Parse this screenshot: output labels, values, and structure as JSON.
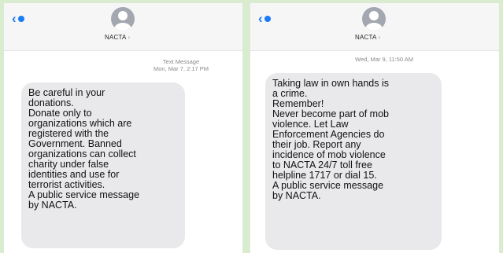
{
  "left_screen": {
    "contact_name": "NACTA",
    "meta_line1": "Text Message",
    "meta_line2": "Mon, Mar 7, 2:17 PM",
    "message_lines": [
      "Be careful in your",
      "donations.",
      "Donate only to",
      "organizations which are",
      "registered with the",
      "Government. Banned",
      "organizations can collect",
      "charity under false",
      "identities and use for",
      "terrorist activities.",
      "A public service message",
      "by NACTA."
    ]
  },
  "right_screen": {
    "contact_name": "NACTA",
    "meta_line1": "Wed, Mar 9, 11:50 AM",
    "message_lines": [
      "Taking law in own hands is",
      "a crime.",
      "Remember!",
      "Never become part of mob",
      "violence. Let Law",
      "Enforcement Agencies do",
      "their job. Report any",
      "incidence of mob violence",
      "to NACTA 24/7 toll free",
      "helpline 1717 or dial 15.",
      "A public service message",
      "by NACTA."
    ]
  },
  "icons": {
    "back": "back-chevron-icon",
    "avatar": "contact-avatar-icon",
    "caret": "chevron-right-icon"
  },
  "colors": {
    "accent": "#1a7cf6",
    "bubble": "#e9e9eb",
    "page_background": "#d9eccf"
  }
}
